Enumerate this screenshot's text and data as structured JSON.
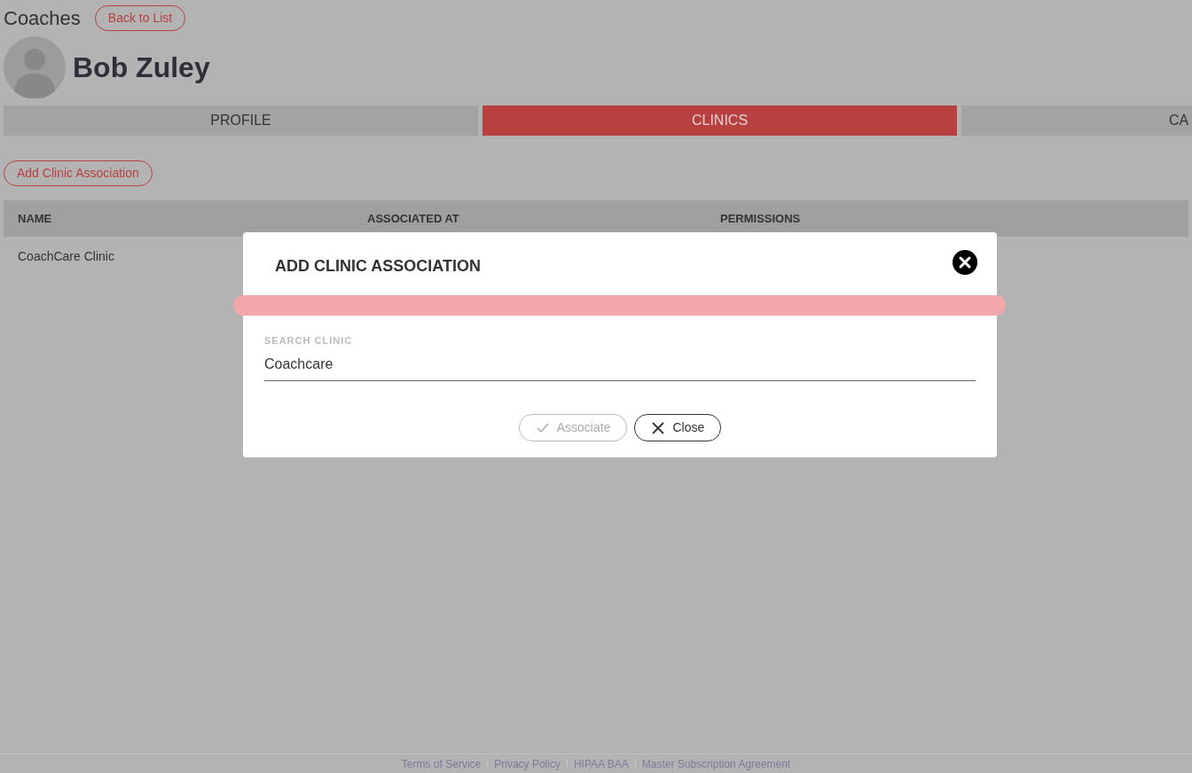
{
  "header": {
    "title": "Coaches",
    "back_button": "Back to List"
  },
  "profile": {
    "name": "Bob Zuley"
  },
  "tabs": [
    {
      "label": "PROFILE",
      "selected": false
    },
    {
      "label": "CLINICS",
      "selected": true
    },
    {
      "label": "CA",
      "selected": false
    }
  ],
  "add_button": "Add Clinic Association",
  "table": {
    "columns": [
      "NAME",
      "ASSOCIATED AT",
      "PERMISSIONS"
    ],
    "rows": [
      {
        "name": "CoachCare Clinic"
      }
    ]
  },
  "modal": {
    "title": "ADD CLINIC ASSOCIATION",
    "field": {
      "label": "SEARCH CLINIC",
      "value": "Coachcare"
    },
    "buttons": [
      {
        "label": "Associate",
        "kind": "check",
        "disabled": true
      },
      {
        "label": "Close",
        "kind": "cross",
        "disabled": false
      }
    ]
  },
  "footer_links": [
    "Terms of Service",
    "Privacy Policy",
    "HIPAA BAA",
    "Master Subscription Agreement"
  ]
}
